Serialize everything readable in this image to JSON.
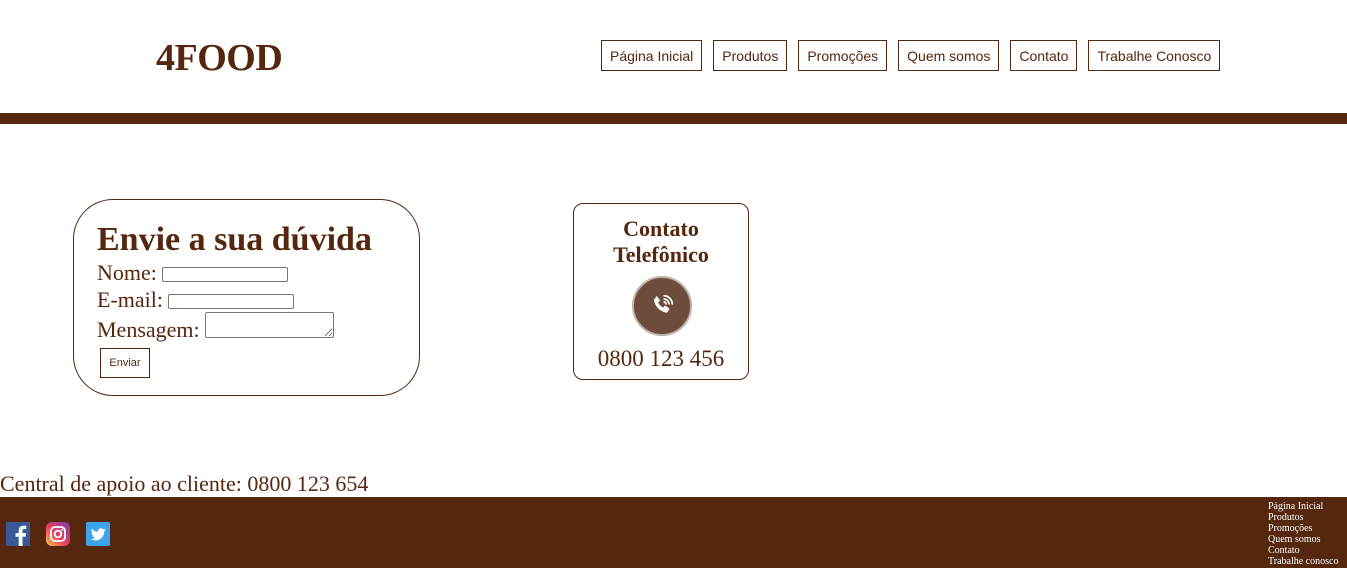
{
  "header": {
    "logo": "4FOOD",
    "nav": [
      "Página Inicial",
      "Produtos",
      "Promoções",
      "Quem somos",
      "Contato",
      "Trabalhe Conosco"
    ]
  },
  "form": {
    "title": "Envie a sua dúvida",
    "name_label": "Nome:",
    "email_label": "E-mail:",
    "message_label": "Mensagem:",
    "submit_label": "Enviar",
    "name_value": "",
    "email_value": "",
    "message_value": ""
  },
  "phone": {
    "title": "Contato Telefônico",
    "icon": "phone-icon",
    "number": "0800 123 456"
  },
  "support": {
    "text": "Central de apoio ao cliente: 0800 123 654"
  },
  "footer": {
    "social": [
      "facebook-icon",
      "instagram-icon",
      "twitter-icon"
    ],
    "links": [
      "Página Inicial",
      "Produtos",
      "Promoções",
      "Quem somos",
      "Contato",
      "Trabalhe conosco"
    ]
  },
  "colors": {
    "brand": "#55270f",
    "phone_icon_bg": "#6d4c3d"
  }
}
